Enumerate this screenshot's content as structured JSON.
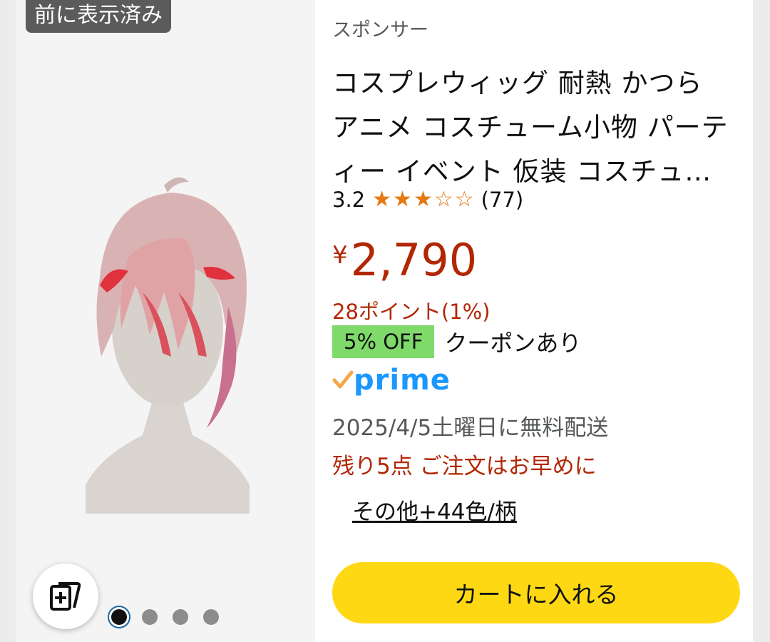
{
  "badge": {
    "seen_label": "前に表示済み"
  },
  "sponsor_label": "スポンサー",
  "product": {
    "title_lines": [
      "コスプレウィッグ 耐熱 かつら",
      "アニメ コスチューム小物 パーテ",
      "ィー イベント 仮装 コスチュ…"
    ],
    "rating": "3.2",
    "stars_filled": 3,
    "stars_total": 5,
    "review_count": "(77)",
    "currency_symbol": "¥",
    "price": "2,790",
    "points": "28ポイント(1%)",
    "coupon_badge": "5% OFF",
    "coupon_text": "クーポンあり",
    "prime_label": "prime",
    "delivery": "2025/4/5土曜日に無料配送",
    "stock_notice": "残り5点 ご注文はお早めに",
    "variants_link": "その他+44色/柄",
    "cart_button": "カートに入れる"
  },
  "carousel": {
    "dot_count": 4,
    "active_index": 0
  },
  "colors": {
    "price": "#b12704",
    "star": "#e47911",
    "coupon_badge": "#7fda69",
    "prime": "#1a98ff",
    "cart_button": "#ffd814"
  },
  "icons": {
    "compare": "card-stack-plus-icon",
    "prime_check": "prime-check-icon"
  }
}
